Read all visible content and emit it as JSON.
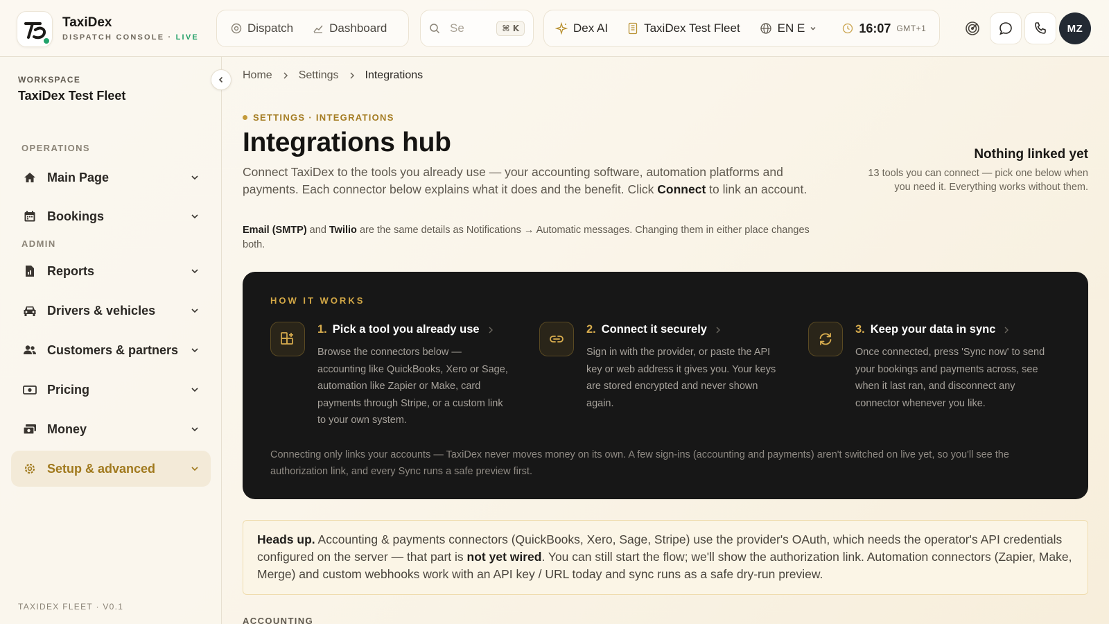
{
  "app": {
    "name": "TaxiDex",
    "subtitle": "DISPATCH CONSOLE",
    "subtitle_sep": " · ",
    "live_label": "LIVE"
  },
  "topnav": {
    "dispatch_label": "Dispatch",
    "dashboard_label": "Dashboard",
    "search_placeholder": "Se",
    "search_shortcut": "⌘ K",
    "ai_label": "Dex AI",
    "fleet_label": "TaxiDex Test Fleet",
    "language_label": "EN E",
    "time": "16:07",
    "timezone": "GMT+1",
    "user_initials": "MZ"
  },
  "sidebar": {
    "workspace_label": "WORKSPACE",
    "workspace_name": "TaxiDex Test Fleet",
    "operations_label": "OPERATIONS",
    "admin_label": "ADMIN",
    "items": [
      {
        "label": "Main Page",
        "icon": "home-icon"
      },
      {
        "label": "Bookings",
        "icon": "calendar-icon"
      },
      {
        "label": "Reports",
        "icon": "report-icon"
      },
      {
        "label": "Drivers & vehicles",
        "icon": "car-icon"
      },
      {
        "label": "Customers & partners",
        "icon": "users-icon"
      },
      {
        "label": "Pricing",
        "icon": "banknote-icon"
      },
      {
        "label": "Money",
        "icon": "money-icon"
      },
      {
        "label": "Setup & advanced",
        "icon": "settings-icon",
        "active": true
      }
    ],
    "footer": "TAXIDEX FLEET · V0.1"
  },
  "breadcrumb": {
    "home": "Home",
    "settings": "Settings",
    "current": "Integrations"
  },
  "header": {
    "eyebrow": "SETTINGS · INTEGRATIONS",
    "title": "Integrations hub",
    "lead_part1": "Connect TaxiDex to the tools you already use — your accounting software, automation platforms and payments. Each connector below explains what it does and the benefit. Click ",
    "lead_bold": "Connect",
    "lead_part2": " to link an account.",
    "note_bold1": "Email (SMTP)",
    "note_and": " and ",
    "note_bold2": "Twilio",
    "note_rest": " are the same details as Notifications → Automatic messages. Changing them in either place changes both."
  },
  "status": {
    "title": "Nothing linked yet",
    "description": "13 tools you can connect — pick one below when you need it. Everything works without them."
  },
  "how_it_works": {
    "label": "HOW IT WORKS",
    "steps": [
      {
        "number": "1.",
        "title": "Pick a tool you already use",
        "icon": "grid-plus-icon",
        "body": "Browse the connectors below — accounting like QuickBooks, Xero or Sage, automation like Zapier or Make, card payments through Stripe, or a custom link to your own system."
      },
      {
        "number": "2.",
        "title": "Connect it securely",
        "icon": "link-icon",
        "body": "Sign in with the provider, or paste the API key or web address it gives you. Your keys are stored encrypted and never shown again."
      },
      {
        "number": "3.",
        "title": "Keep your data in sync",
        "icon": "refresh-icon",
        "body": "Once connected, press 'Sync now' to send your bookings and payments across, see when it last ran, and disconnect any connector whenever you like."
      }
    ],
    "footer": "Connecting only links your accounts — TaxiDex never moves money on its own. A few sign-ins (accounting and payments) aren't switched on live yet, so you'll see the authorization link, and every Sync runs a safe preview first."
  },
  "headsup": {
    "bold_intro": "Heads up.",
    "part1": " Accounting & payments connectors (QuickBooks, Xero, Sage, Stripe) use the provider's OAuth, which needs the operator's API credentials configured on the server — that part is ",
    "bold_mid": "not yet wired",
    "part2": ". You can still start the flow; we'll show the authorization link. Automation connectors (Zapier, Make, Merge) and custom webhooks work with an API key / URL today and sync runs as a safe dry-run preview."
  },
  "sections": {
    "accounting": "ACCOUNTING"
  },
  "colors": {
    "accent_gold": "#c49a3a",
    "live_green": "#23a068",
    "dark_card": "#171717"
  }
}
